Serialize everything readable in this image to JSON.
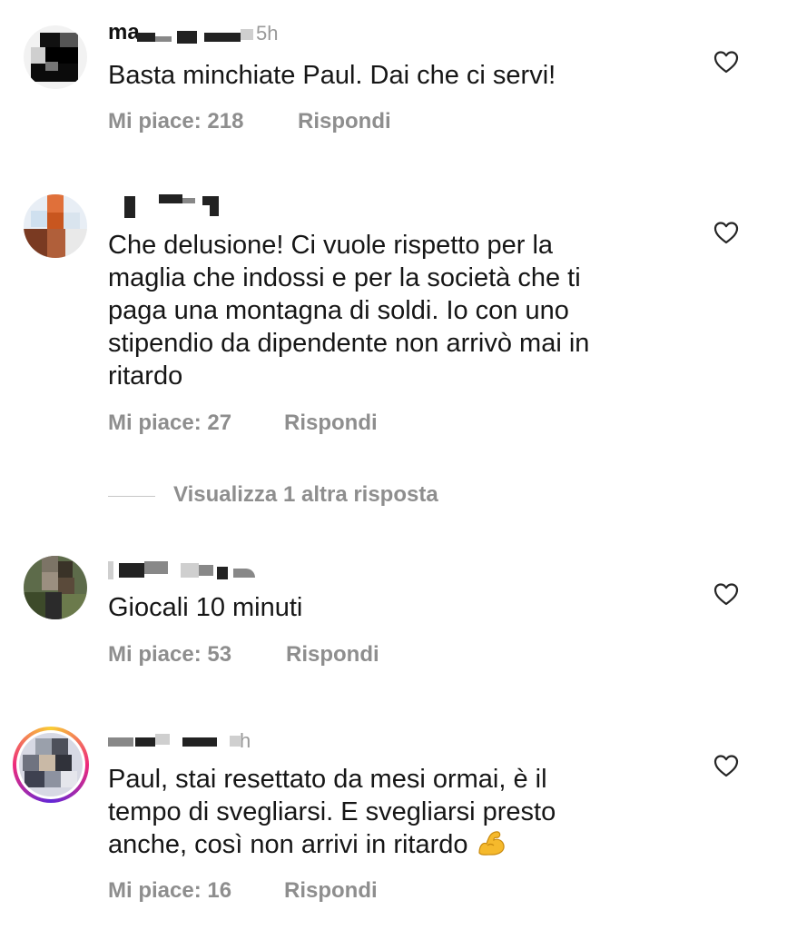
{
  "comments": [
    {
      "username_visible": "ma",
      "time": "5h",
      "text": "Basta minchiate Paul. Dai che ci servi!",
      "likes_label": "Mi piace:",
      "likes": "218",
      "reply_label": "Rispondi"
    },
    {
      "time": "",
      "text": "Che delusione! Ci vuole rispetto per la\nmaglia che indossi e per la società che ti\npaga una montagna di soldi. Io con uno\nstipendio da dipendente non arrivò mai in\nritardo",
      "likes_label": "Mi piace:",
      "likes": "27",
      "reply_label": "Rispondi"
    },
    {
      "time": "",
      "text": "Giocali 10 minuti",
      "likes_label": "Mi piace:",
      "likes": "53",
      "reply_label": "Rispondi"
    },
    {
      "time": "h",
      "text": "Paul, stai resettato da mesi ormai, è il\ntempo di svegliarsi. E svegliarsi presto\nanche, così non arrivi in ritardo",
      "likes_label": "Mi piace:",
      "likes": "16",
      "reply_label": "Rispondi"
    }
  ],
  "view_replies_label": "Visualizza 1 altra risposta",
  "icons": {
    "like": "heart-outline-icon",
    "emoji": "flexed-biceps-emoji"
  },
  "colors": {
    "text": "#161616",
    "secondary": "#8e8e8e",
    "heart_stroke": "#262626"
  }
}
